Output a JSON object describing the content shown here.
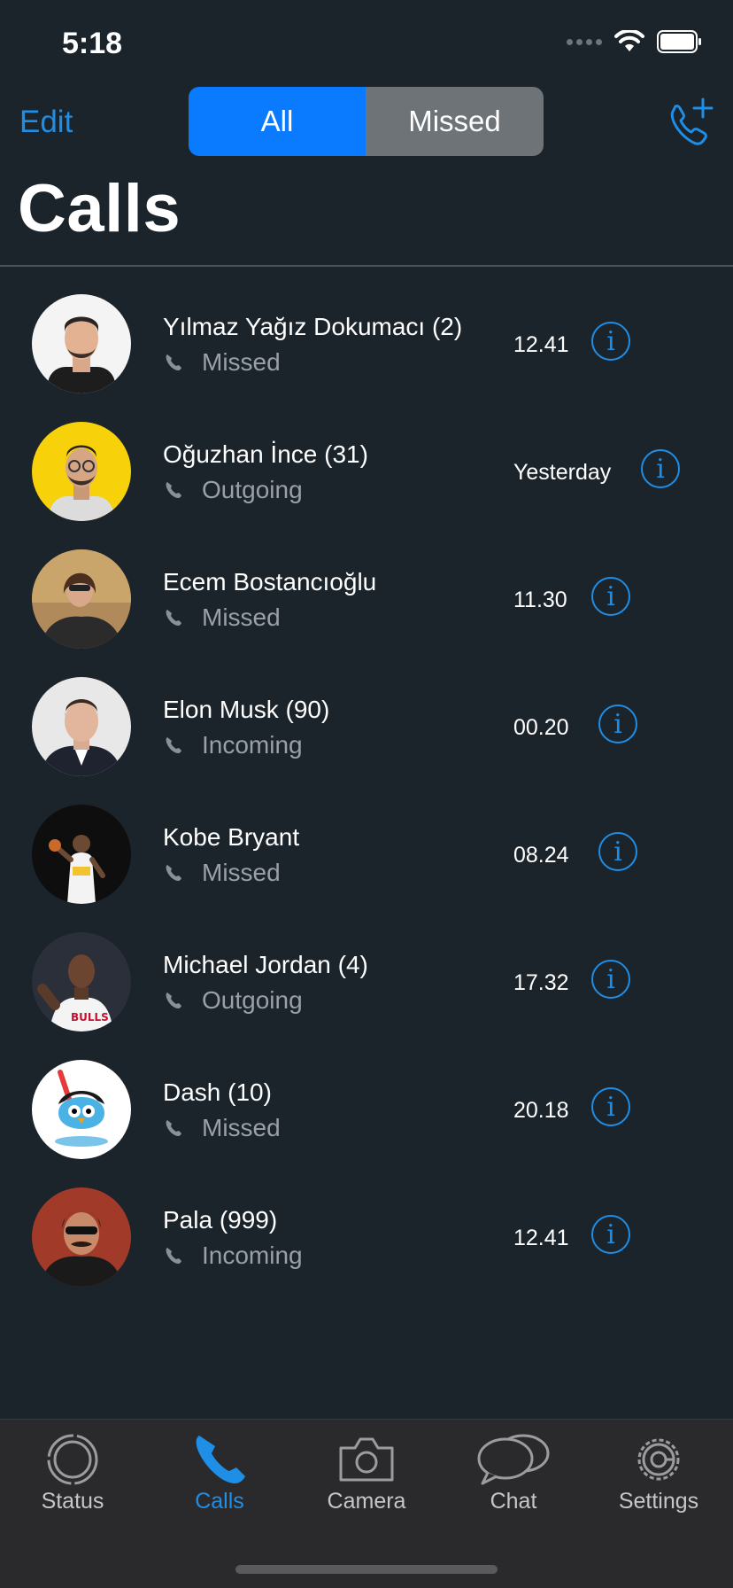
{
  "status_bar": {
    "time": "5:18"
  },
  "nav": {
    "edit_label": "Edit",
    "segments": {
      "all": "All",
      "missed": "Missed"
    },
    "title": "Calls"
  },
  "calls": [
    {
      "name": "Yılmaz Yağız Dokumacı (2)",
      "type": "Missed",
      "time": "12.41"
    },
    {
      "name": "Oğuzhan İnce (31)",
      "type": "Outgoing",
      "time": "Yesterday"
    },
    {
      "name": "Ecem Bostancıoğlu",
      "type": "Missed",
      "time": "11.30"
    },
    {
      "name": "Elon Musk (90)",
      "type": "Incoming",
      "time": "00.20"
    },
    {
      "name": "Kobe Bryant",
      "type": "Missed",
      "time": "08.24"
    },
    {
      "name": "Michael Jordan (4)",
      "type": "Outgoing",
      "time": "17.32"
    },
    {
      "name": "Dash (10)",
      "type": "Missed",
      "time": "20.18"
    },
    {
      "name": "Pala (999)",
      "type": "Incoming",
      "time": "12.41"
    }
  ],
  "info_glyph": "i",
  "tabs": [
    {
      "label": "Status",
      "icon": "status-icon",
      "active": false
    },
    {
      "label": "Calls",
      "icon": "phone-icon",
      "active": true
    },
    {
      "label": "Camera",
      "icon": "camera-icon",
      "active": false
    },
    {
      "label": "Chat",
      "icon": "chat-icon",
      "active": false
    },
    {
      "label": "Settings",
      "icon": "gear-icon",
      "active": false
    }
  ],
  "colors": {
    "background": "#1b232b",
    "accent": "#1e8ee6",
    "segment_active": "#0a7aff",
    "segment_inactive": "#6d7377",
    "secondary_text": "#9aa0a6",
    "tab_bar": "#2a2a2c"
  }
}
